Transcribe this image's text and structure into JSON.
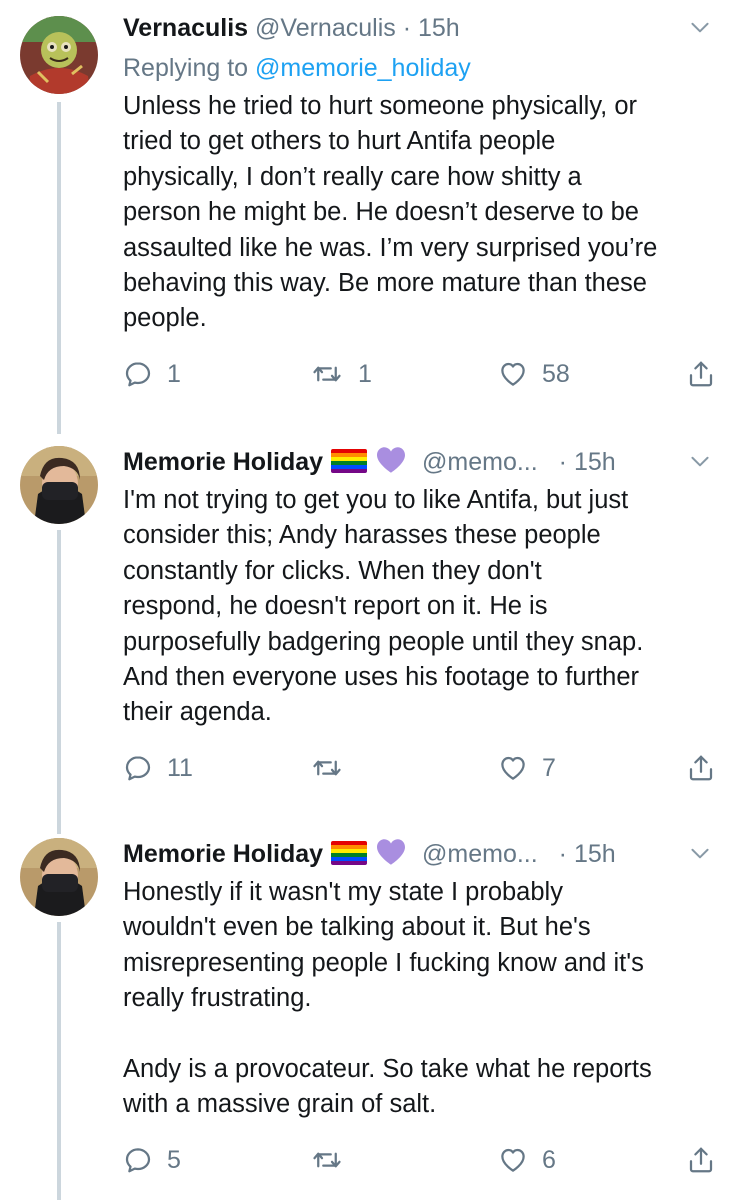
{
  "tweets": [
    {
      "name": "Vernaculis",
      "handle": "@Vernaculis",
      "dot": "·",
      "time": "15h",
      "reply_prefix": "Replying to ",
      "reply_mention": "@memorie_holiday",
      "text": "Unless he tried to hurt someone physically, or\ntried to get others to hurt Antifa people\nphysically, I don’t really care how shitty a\nperson he might be. He doesn’t deserve to be\nassaulted like he was. I’m very surprised you’re\nbehaving this way. Be more mature than these\npeople.",
      "replies": "1",
      "retweets": "1",
      "likes": "58"
    },
    {
      "name": "Memorie Holiday",
      "handle": "@memo...",
      "dot": "·",
      "time": "15h",
      "text": "I'm not trying to get you to like Antifa, but just\nconsider this; Andy harasses these people\nconstantly for clicks. When they don't\nrespond, he doesn't report on it. He is\npurposefully badgering people until they snap.\nAnd then everyone uses his footage to further\ntheir agenda.",
      "replies": "11",
      "retweets": "",
      "likes": "7"
    },
    {
      "name": "Memorie Holiday",
      "handle": "@memo...",
      "dot": "·",
      "time": "15h",
      "text": "Honestly if it wasn't my state I probably\nwouldn't even be talking about it. But he's\nmisrepresenting people I fucking know and it's\nreally frustrating.\n\nAndy is a provocateur. So take what he reports\nwith a massive grain of salt.",
      "replies": "5",
      "retweets": "",
      "likes": "6"
    }
  ],
  "colors": {
    "text": "#14171a",
    "secondary": "#657786",
    "link": "#1da1f2",
    "thread_line": "#ccd6dd",
    "heart_emoji": "#a98ee0"
  },
  "icons": [
    "reply-icon",
    "retweet-icon",
    "like-icon",
    "share-icon",
    "chevron-down-icon",
    "rainbow-flag-icon",
    "purple-heart-icon"
  ]
}
